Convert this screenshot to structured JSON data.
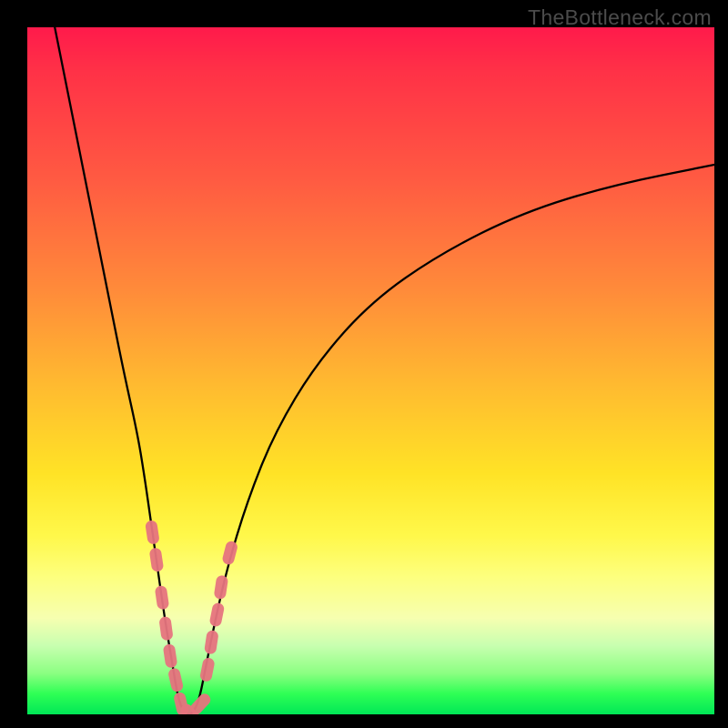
{
  "watermark": "TheBottleneck.com",
  "chart_data": {
    "type": "line",
    "title": "",
    "xlabel": "",
    "ylabel": "",
    "xlim": [
      0,
      100
    ],
    "ylim": [
      0,
      100
    ],
    "series": [
      {
        "name": "bottleneck-curve",
        "x": [
          4,
          6,
          8,
          10,
          12,
          14,
          16,
          17,
          18,
          19,
          20,
          21,
          22,
          23,
          24,
          25,
          26,
          27,
          29,
          32,
          36,
          42,
          50,
          60,
          72,
          85,
          100
        ],
        "y": [
          100,
          90,
          80,
          70,
          60,
          50,
          41,
          35,
          28,
          21,
          14,
          8,
          2,
          0,
          0,
          2,
          7,
          12,
          21,
          31,
          41,
          51,
          60,
          67,
          73,
          77,
          80
        ]
      }
    ],
    "markers": {
      "name": "highlight-points",
      "x": [
        18.2,
        18.8,
        19.6,
        20.2,
        20.8,
        21.6,
        22.4,
        23.8,
        25.2,
        26.2,
        26.8,
        27.6,
        28.2,
        29.5
      ],
      "y": [
        26.5,
        22.5,
        17.0,
        12.5,
        8.5,
        5.0,
        1.5,
        0.0,
        1.5,
        6.5,
        10.5,
        14.5,
        18.5,
        23.5
      ]
    },
    "colors": {
      "curve": "#000000",
      "marker": "#e6747e"
    }
  }
}
